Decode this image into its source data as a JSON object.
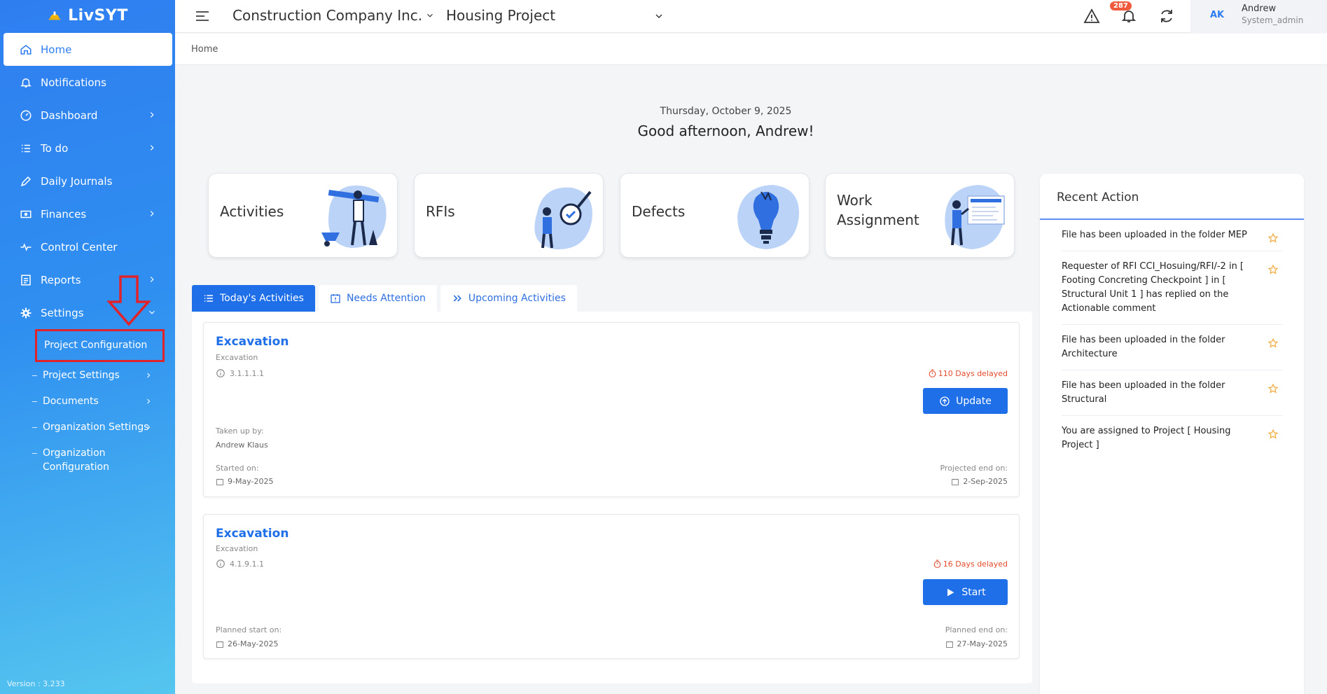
{
  "sidebar": {
    "brand": "LivSYT",
    "version": "Version : 3.233",
    "items": [
      {
        "label": "Home"
      },
      {
        "label": "Notifications"
      },
      {
        "label": "Dashboard"
      },
      {
        "label": "To do"
      },
      {
        "label": "Daily Journals"
      },
      {
        "label": "Finances"
      },
      {
        "label": "Control Center"
      },
      {
        "label": "Reports"
      },
      {
        "label": "Settings"
      }
    ],
    "settings_sub": [
      {
        "label": "Project Configuration"
      },
      {
        "label": "Project Settings"
      },
      {
        "label": "Documents"
      },
      {
        "label": "Organization Settings"
      },
      {
        "label": "Organization Configuration"
      }
    ]
  },
  "topbar": {
    "company": "Construction Company Inc.",
    "project": "Housing Project",
    "notification_count": "287",
    "user_initials": "AK",
    "user_name": "Andrew",
    "user_role": "System_admin"
  },
  "breadcrumb": "Home",
  "greeting": {
    "date": "Thursday, October 9, 2025",
    "message": "Good afternoon, Andrew!"
  },
  "cards": [
    {
      "label": "Activities"
    },
    {
      "label": "RFIs"
    },
    {
      "label": "Defects"
    },
    {
      "label": "Work Assignment"
    }
  ],
  "tabs": [
    {
      "label": "Today's Activities"
    },
    {
      "label": "Needs Attention"
    },
    {
      "label": "Upcoming Activities"
    }
  ],
  "activities": [
    {
      "name": "Excavation",
      "subtitle": "Excavation",
      "code": "3.1.1.1.1",
      "delay": "110 Days delayed",
      "button": "Update",
      "person_label": "Taken up by:",
      "person": "Andrew Klaus",
      "start_label": "Started on:",
      "start": "9-May-2025",
      "end_label": "Projected end on:",
      "end": "2-Sep-2025"
    },
    {
      "name": "Excavation",
      "subtitle": "Excavation",
      "code": "4.1.9.1.1",
      "delay": "16 Days delayed",
      "button": "Start",
      "start_label": "Planned start on:",
      "start": "26-May-2025",
      "end_label": "Planned end on:",
      "end": "27-May-2025"
    }
  ],
  "recent": {
    "title": "Recent Action",
    "items": [
      {
        "text": "File has been uploaded in the folder MEP"
      },
      {
        "text": "Requester of RFI CCI_Hosuing/RFI/-2 in [ Footing Concreting Checkpoint ] in [ Structural Unit 1 ] has replied on the Actionable comment"
      },
      {
        "text": "File has been uploaded in the folder Architecture"
      },
      {
        "text": "File has been uploaded in the folder Structural"
      },
      {
        "text": "You are assigned to Project [ Housing Project ]"
      }
    ]
  },
  "colors": {
    "primary": "#1f6fe8",
    "delay": "#e34b2c",
    "highlight": "#e0232b",
    "badge": "#f05a3c"
  }
}
